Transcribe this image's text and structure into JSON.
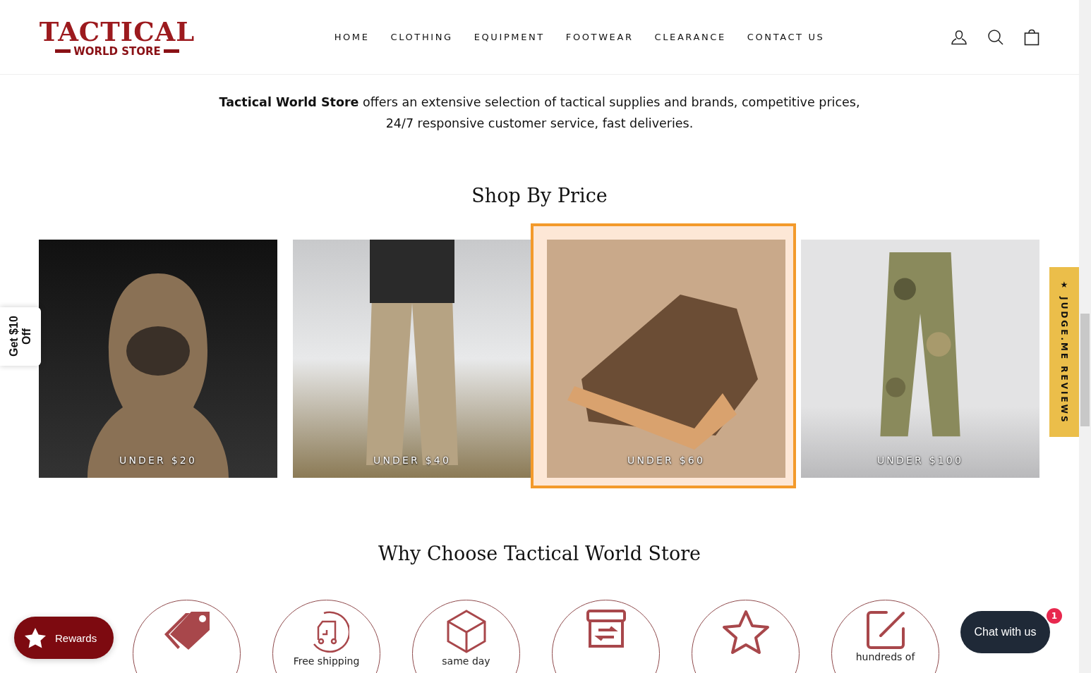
{
  "logo": {
    "title": "TACTICAL",
    "subtitle": "WORLD STORE"
  },
  "nav": [
    {
      "label": "HOME"
    },
    {
      "label": "CLOTHING"
    },
    {
      "label": "EQUIPMENT"
    },
    {
      "label": "FOOTWEAR"
    },
    {
      "label": "CLEARANCE"
    },
    {
      "label": "CONTACT US"
    }
  ],
  "intro": "**Tactical World Store** offers an extensive selection of tactical supplies and brands, competitive prices, 24/7 responsive customer service, fast deliveries.",
  "shop_by_price": {
    "title": "Shop By Price",
    "cards": [
      {
        "kind": "balaclava",
        "label": "UNDER $20",
        "selected": false
      },
      {
        "kind": "trousers",
        "label": "UNDER $40",
        "selected": false
      },
      {
        "kind": "boot",
        "label": "UNDER $60",
        "selected": true
      },
      {
        "kind": "camo",
        "label": "UNDER $100",
        "selected": false
      }
    ]
  },
  "why_choose": {
    "title": "Why Choose Tactical World Store",
    "features": [
      {
        "kind": "tag"
      },
      {
        "kind": "truck",
        "label": "Free shipping"
      },
      {
        "kind": "cube",
        "label": "same day"
      },
      {
        "kind": "box"
      },
      {
        "kind": "star"
      },
      {
        "kind": "edit",
        "label": "hundreds of"
      }
    ]
  },
  "discount_tab": "Get $10 Off",
  "reviews_tab": "★ JUDGE.ME REVIEWS",
  "rewards_button": "Rewards",
  "chat": {
    "label": "Chat with us",
    "badge": "1"
  }
}
